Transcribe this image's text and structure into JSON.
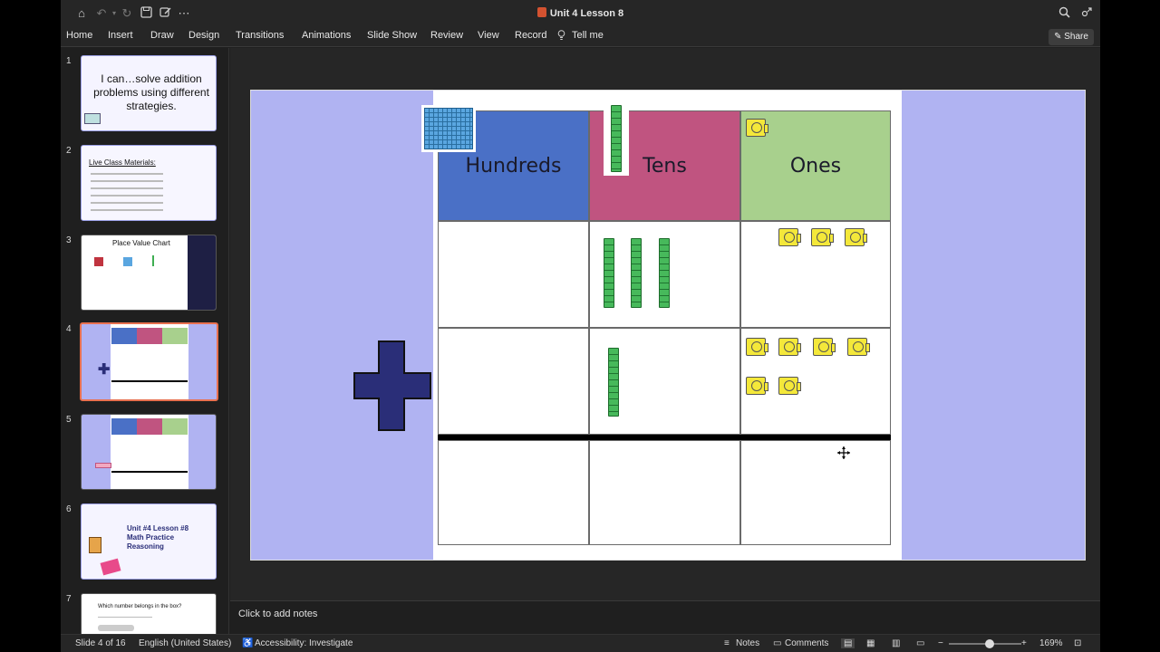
{
  "window": {
    "title": "Unit 4 Lesson 8"
  },
  "menu": [
    "Home",
    "Insert",
    "Draw",
    "Design",
    "Transitions",
    "Animations",
    "Slide Show",
    "Review",
    "View",
    "Record",
    "Tell me"
  ],
  "share_label": "Share",
  "thumbnails": [
    {
      "number": "1",
      "text": "I can…solve addition problems using different strategies."
    },
    {
      "number": "2",
      "text": "Live Class Materials:"
    },
    {
      "number": "3",
      "text": "Place Value Chart"
    },
    {
      "number": "4",
      "text": ""
    },
    {
      "number": "5",
      "text": ""
    },
    {
      "number": "6",
      "text": "Unit #4 Lesson #8 Math Practice Reasoning"
    },
    {
      "number": "7",
      "text": "Which number belongs in the box?"
    }
  ],
  "slide": {
    "headers": [
      "Hundreds",
      "Tens",
      "Ones"
    ],
    "rows": [
      {
        "tens_rods": 3,
        "ones_units": 3
      },
      {
        "tens_rods": 1,
        "ones_units": 6
      }
    ],
    "operator": "plus",
    "colors": {
      "hundreds": "#4a70c6",
      "tens": "#c05480",
      "ones": "#a8d08d",
      "background": "#b0b3f2",
      "plus": "#2a2e78"
    }
  },
  "notes_placeholder": "Click to add notes",
  "status": {
    "slide_position": "Slide 4 of 16",
    "language": "English (United States)",
    "accessibility": "Accessibility: Investigate",
    "notes": "Notes",
    "comments": "Comments",
    "zoom": "169%"
  }
}
